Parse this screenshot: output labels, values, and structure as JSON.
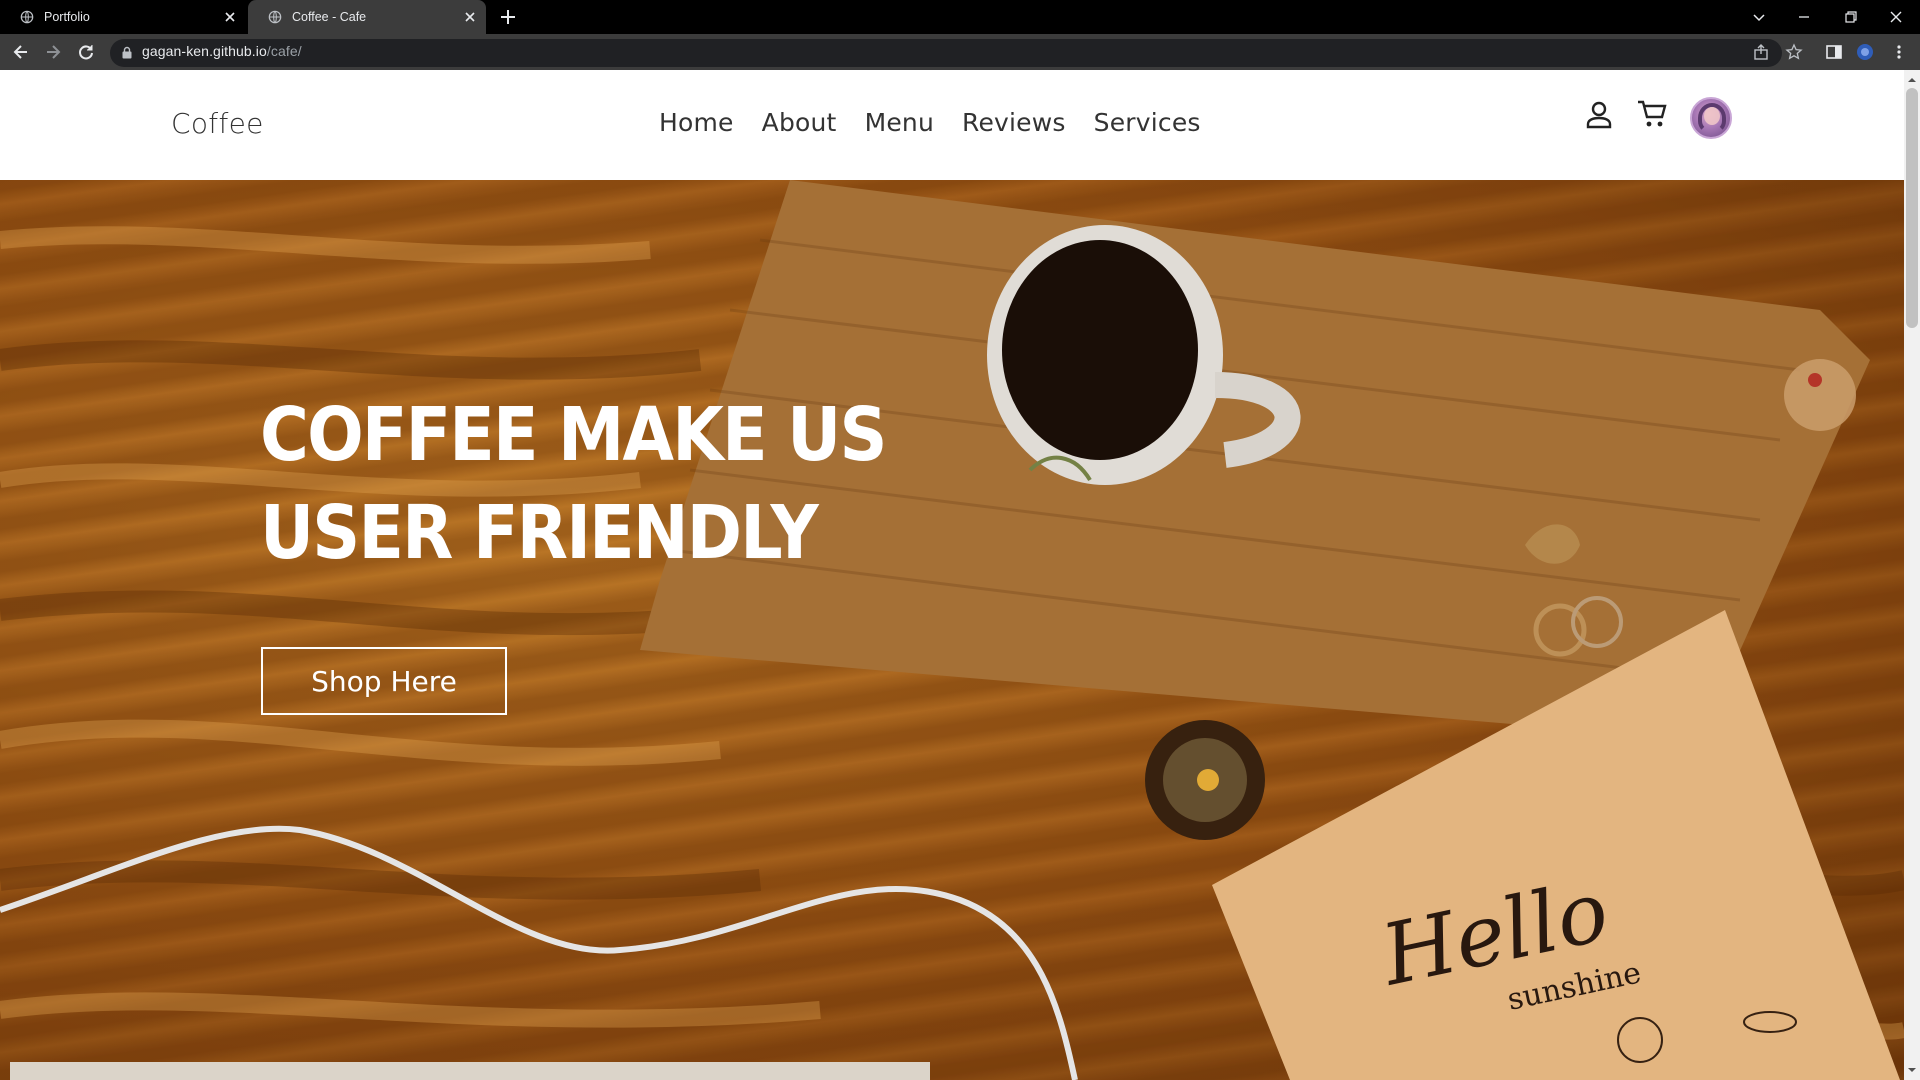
{
  "browser": {
    "tabs": [
      {
        "title": "Portfolio",
        "active": false
      },
      {
        "title": "Coffee - Cafe",
        "active": true
      }
    ],
    "url_host": "gagan-ken.github.io",
    "url_path": "/cafe/"
  },
  "site": {
    "logo": "Coffee",
    "nav": [
      {
        "label": "Home"
      },
      {
        "label": "About"
      },
      {
        "label": "Menu"
      },
      {
        "label": "Reviews"
      },
      {
        "label": "Services"
      }
    ],
    "header_icons": [
      "user-icon",
      "cart-icon",
      "avatar"
    ]
  },
  "hero": {
    "title_line1": "COFFEE MAKE US",
    "title_line2": "USER FRIENDLY",
    "cta_label": "Shop Here",
    "card_text_1": "Hello",
    "card_text_2": "sunshine"
  },
  "colors": {
    "chrome_dark": "#000000",
    "toolbar": "#3c3c3c",
    "text_dark": "#333333",
    "hero_brown": "#9b5414",
    "white": "#ffffff"
  }
}
